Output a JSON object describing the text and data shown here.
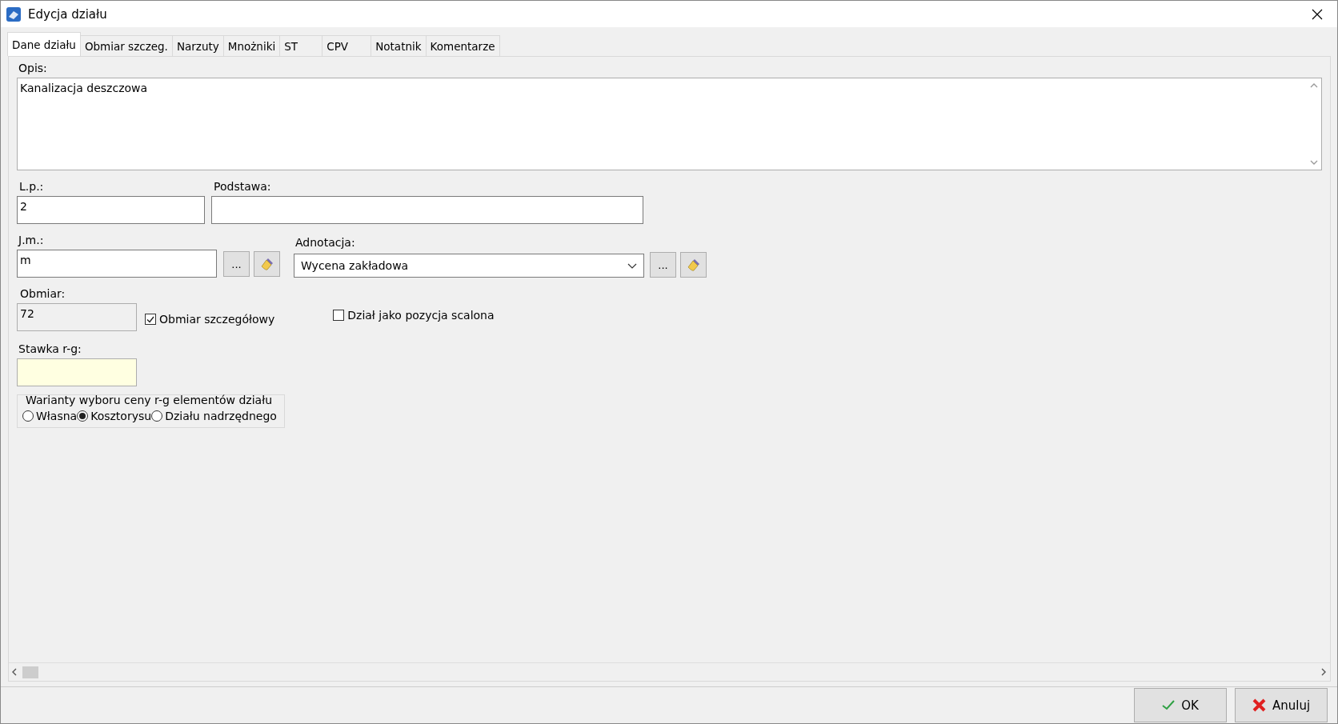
{
  "window": {
    "title": "Edycja działu"
  },
  "tabs": [
    {
      "label": "Dane działu",
      "selected": true
    },
    {
      "label": "Obmiar szczeg.",
      "selected": false
    },
    {
      "label": "Narzuty",
      "selected": false
    },
    {
      "label": "Mnożniki",
      "selected": false
    },
    {
      "label": "ST",
      "selected": false
    },
    {
      "label": "CPV",
      "selected": false
    },
    {
      "label": "Notatnik",
      "selected": false
    },
    {
      "label": "Komentarze",
      "selected": false
    }
  ],
  "opis": {
    "label": "Opis:",
    "value": "Kanalizacja deszczowa"
  },
  "lp": {
    "label": "L.p.:",
    "value": "2"
  },
  "podstawa": {
    "label": "Podstawa:"
  },
  "jm": {
    "label": "J.m.:",
    "value": "m",
    "browse": "..."
  },
  "adnotacja": {
    "label": "Adnotacja:",
    "value": "Wycena zakładowa",
    "browse": "..."
  },
  "obmiar": {
    "label": "Obmiar:",
    "value": "72"
  },
  "checkboxes": [
    {
      "label": "Obmiar szczegółowy",
      "checked": true
    },
    {
      "label": "Dział jako pozycja scalona",
      "checked": false
    }
  ],
  "stawka": {
    "label": "Stawka r-g:"
  },
  "warianty": {
    "title": "Warianty wyboru ceny r-g elementów działu",
    "options": [
      {
        "label": "Własna",
        "selected": false
      },
      {
        "label": "Kosztorysu",
        "selected": true
      },
      {
        "label": "Działu nadrzędnego",
        "selected": false
      }
    ]
  },
  "buttons": [
    {
      "kind": "ok",
      "label": "OK"
    },
    {
      "kind": "cancel",
      "label": "Anuluj"
    }
  ]
}
